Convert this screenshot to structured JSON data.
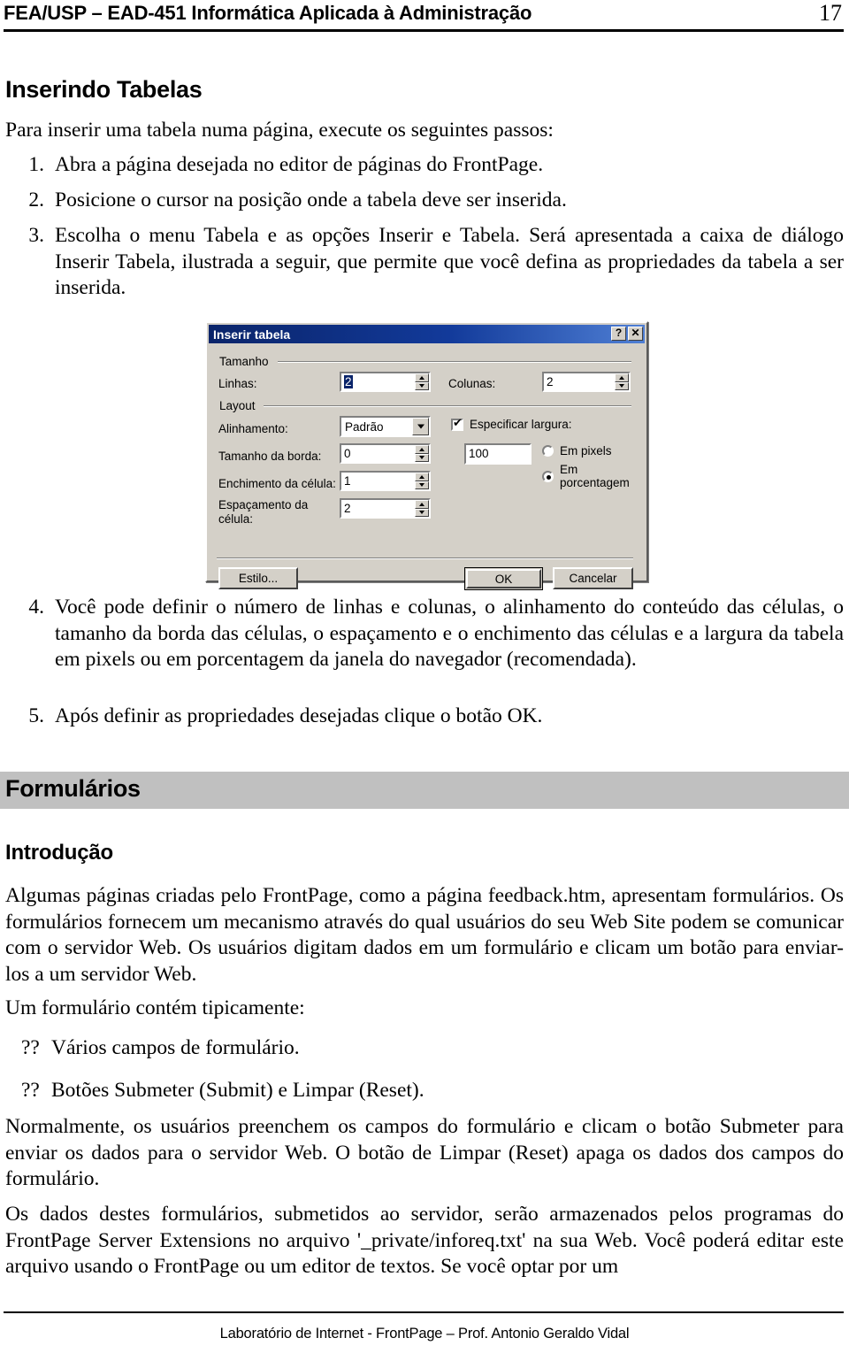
{
  "header": {
    "title": "FEA/USP – EAD-451 Informática Aplicada à Administração",
    "page_number": "17"
  },
  "sections": {
    "inserindo_tabelas": {
      "heading": "Inserindo Tabelas",
      "intro": "Para inserir uma tabela numa página, execute os seguintes passos:",
      "steps": [
        {
          "num": "1.",
          "text": "Abra a página desejada no editor de páginas do FrontPage."
        },
        {
          "num": "2.",
          "text": "Posicione o cursor na posição onde a tabela deve ser inserida."
        },
        {
          "num": "3.",
          "text": "Escolha o menu Tabela e as opções Inserir e Tabela. Será apresentada a caixa de diálogo Inserir Tabela, ilustrada a seguir, que permite que você defina as propriedades da tabela a ser inserida."
        },
        {
          "num": "4.",
          "text": "Você pode definir o número de linhas e colunas, o alinhamento do conteúdo das células, o tamanho da borda das células, o espaçamento e o enchimento das células e a largura da tabela em pixels ou em porcentagem da janela do navegador (recomendada)."
        },
        {
          "num": "5.",
          "text": "Após definir as propriedades desejadas clique o botão OK."
        }
      ]
    },
    "formularios": {
      "heading": "Formulários",
      "subheading": "Introdução",
      "paragraphs": [
        "Algumas páginas criadas pelo FrontPage, como a página feedback.htm, apresentam formulários. Os formulários fornecem um mecanismo através do qual usuários do seu Web Site podem se comunicar com o servidor Web. Os usuários digitam dados em um formulário e clicam um botão para enviar-los a um servidor Web.",
        "Um formulário contém tipicamente:"
      ],
      "bullets": [
        {
          "marker": "??",
          "text": "Vários campos de formulário."
        },
        {
          "marker": "??",
          "text": "Botões Submeter (Submit) e Limpar (Reset)."
        }
      ],
      "paragraphs_after": [
        "Normalmente, os usuários preenchem os campos do formulário e clicam o botão Submeter para enviar os dados para o servidor Web. O botão de Limpar (Reset) apaga os dados dos campos do formulário.",
        "Os dados destes formulários, submetidos ao servidor, serão armazenados pelos programas do FrontPage Server Extensions no arquivo '_private/inforeq.txt' na sua Web. Você poderá editar este arquivo usando o FrontPage ou um editor de textos. Se você optar por um"
      ]
    }
  },
  "dialog": {
    "title": "Inserir tabela",
    "help_button": "?",
    "close_button": "✕",
    "groups": {
      "tamanho": {
        "caption": "Tamanho",
        "linhas_label": "Linhas:",
        "linhas_value": "2",
        "colunas_label": "Colunas:",
        "colunas_value": "2"
      },
      "layout": {
        "caption": "Layout",
        "alinhamento_label": "Alinhamento:",
        "alinhamento_value": "Padrão",
        "borda_label": "Tamanho da borda:",
        "borda_value": "0",
        "enchimento_label": "Enchimento da célula:",
        "enchimento_value": "1",
        "espacamento_label": "Espaçamento da célula:",
        "espacamento_value": "2",
        "especificar_largura_label": "Especificar largura:",
        "largura_value": "100",
        "em_pixels_label": "Em pixels",
        "em_porcentagem_label": "Em porcentagem"
      }
    },
    "buttons": {
      "estilo": "Estilo...",
      "ok": "OK",
      "cancelar": "Cancelar"
    },
    "colors": {
      "face": "#d4d0c8",
      "titlebar_start": "#0a246a",
      "titlebar_end": "#4f7fd4",
      "selection": "#0a246a"
    }
  },
  "footer": {
    "text": "Laboratório de Internet - FrontPage – Prof. Antonio Geraldo Vidal"
  }
}
